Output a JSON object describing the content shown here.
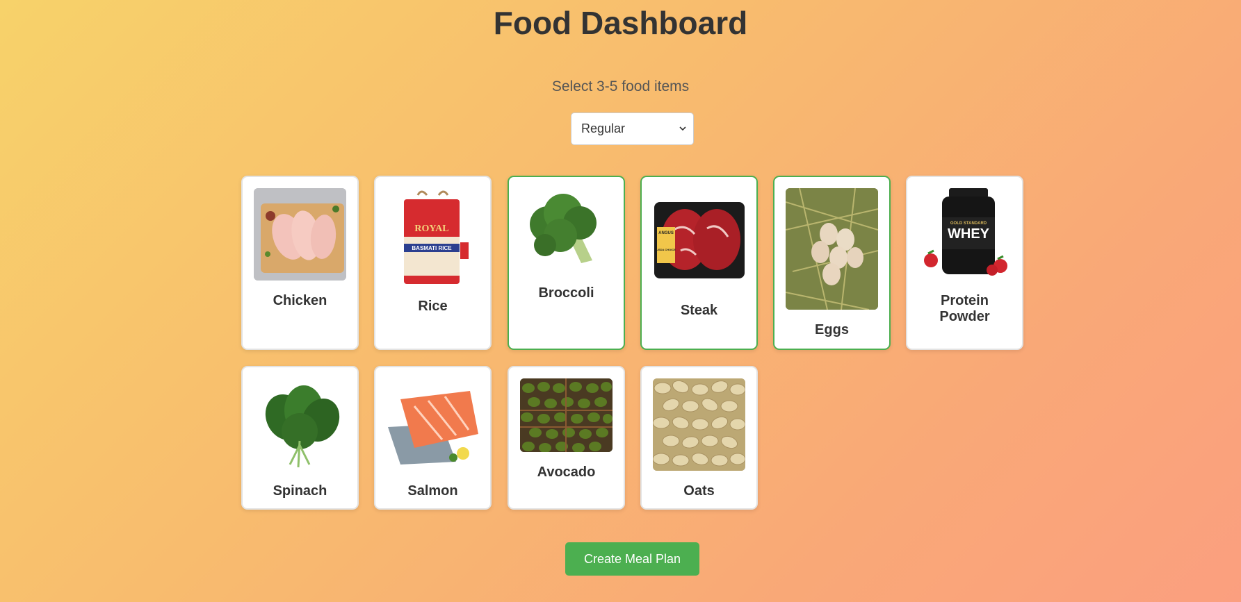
{
  "header": {
    "title": "Food Dashboard",
    "subtitle": "Select 3-5 food items"
  },
  "diet_select": {
    "selected": "Regular"
  },
  "foods": [
    {
      "label": "Chicken",
      "selected": false
    },
    {
      "label": "Rice",
      "selected": false
    },
    {
      "label": "Broccoli",
      "selected": true
    },
    {
      "label": "Steak",
      "selected": true
    },
    {
      "label": "Eggs",
      "selected": true
    },
    {
      "label": "Protein",
      "label2": "Powder",
      "selected": false
    },
    {
      "label": "Spinach",
      "selected": false
    },
    {
      "label": "Salmon",
      "selected": false
    },
    {
      "label": "Avocado",
      "selected": false
    },
    {
      "label": "Oats",
      "selected": false
    }
  ],
  "rice_bag": {
    "brand": "ROYAL",
    "product": "BASMATI RICE"
  },
  "steak_tag": {
    "brand": "ANGUS",
    "grade": "USDA CHOICE"
  },
  "protein_jar": {
    "line": "GOLD STANDARD",
    "product": "WHEY"
  },
  "footer": {
    "cta_label": "Create Meal Plan"
  },
  "colors": {
    "accent": "#4caf50",
    "selected_border": "#4caf50"
  }
}
